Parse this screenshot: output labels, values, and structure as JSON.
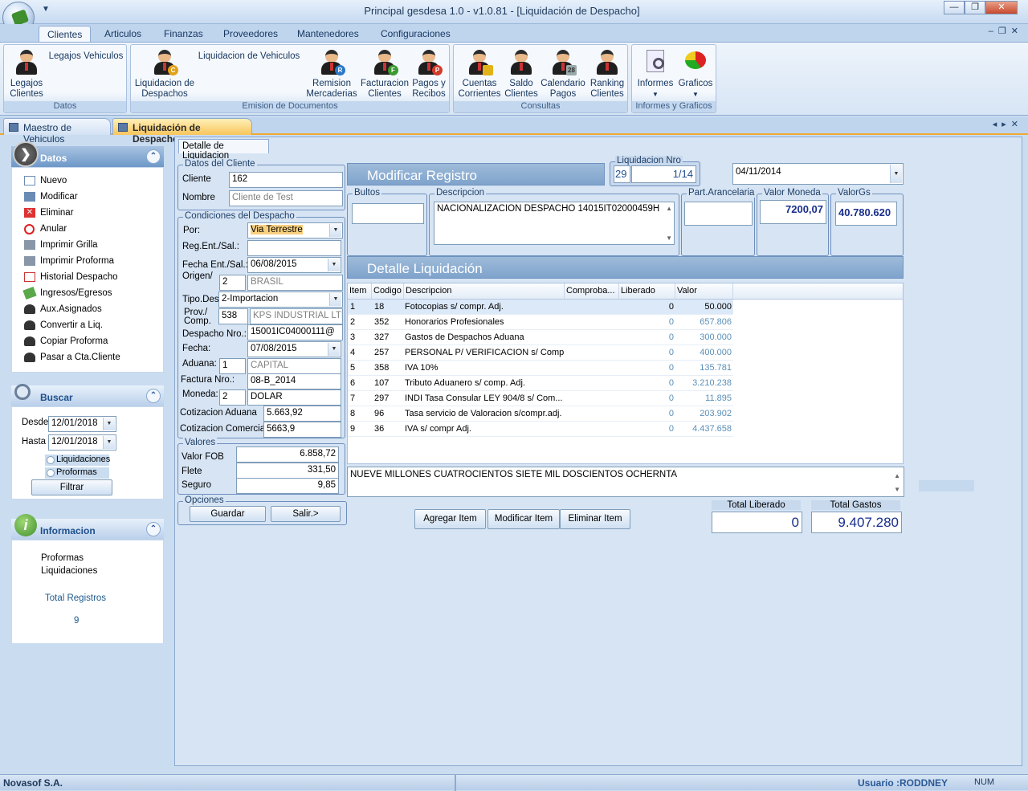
{
  "app": {
    "title": "Principal gesdesa 1.0 - v1.0.81 - [Liquidación de Despacho]"
  },
  "ribbon": {
    "tabs": [
      "Clientes",
      "Articulos",
      "Finanzas",
      "Proveedores",
      "Mantenedores",
      "Configuraciones"
    ],
    "groups": {
      "datos": {
        "label": "Datos",
        "buttons": [
          "Legajos Clientes",
          "Legajos Vehiculos"
        ]
      },
      "emision": {
        "label": "Emision de Documentos",
        "buttons": [
          "Liquidacion de Despachos",
          "Liquidacion de Vehiculos",
          "Remision Mercaderias",
          "Facturacion Clientes",
          "Pagos y Recibos"
        ]
      },
      "consultas": {
        "label": "Consultas",
        "buttons": [
          "Cuentas Corrientes",
          "Saldo Clientes",
          "Calendario Pagos",
          "Ranking Clientes"
        ]
      },
      "informes": {
        "label": "Informes y Graficos",
        "buttons": [
          "Informes",
          "Graficos"
        ]
      }
    }
  },
  "doc_tabs": [
    "Maestro de Vehiculos",
    "Liquidación de Despacho"
  ],
  "left": {
    "datos": {
      "title": "Datos",
      "items": [
        "Nuevo",
        "Modificar",
        "Eliminar",
        "Anular",
        "Imprimir Grilla",
        "Imprimir Proforma",
        "Historial Despacho",
        "Ingresos/Egresos",
        "Aux.Asignados",
        "Convertir a Liq.",
        "Copiar Proforma",
        "Pasar a Cta.Cliente"
      ]
    },
    "buscar": {
      "title": "Buscar",
      "desde_label": "Desde",
      "desde": "12/01/2018",
      "hasta_label": "Hasta",
      "hasta": "12/01/2018",
      "opt1": "Liquidaciones",
      "opt2": "Proformas",
      "filtrar": "Filtrar"
    },
    "info": {
      "title": "Informacion",
      "line1": "Proformas",
      "line2": "Liquidaciones",
      "total_label": "Total Registros",
      "total": "9"
    }
  },
  "form": {
    "tab": "Detalle de Liquidacion",
    "cliente": {
      "legend": "Datos del Cliente",
      "cliente_label": "Cliente",
      "cliente": "162",
      "nombre_label": "Nombre",
      "nombre_placeholder": "Cliente de Test"
    },
    "condiciones": {
      "legend": "Condiciones del Despacho",
      "por_label": "Por:",
      "por": "Via Terrestre",
      "reg_label": "Reg.Ent./Sal.:",
      "reg": "",
      "fecha_ent_label": "Fecha Ent./Sal.:",
      "fecha_ent": "06/08/2015",
      "origen_label": "Origen/",
      "origen_code": "2",
      "origen": "BRASIL",
      "tipo_label": "Tipo.Des",
      "tipo": "2-Importacion",
      "prov_label1": "Prov./",
      "prov_label2": "Comp.",
      "prov_code": "538",
      "prov": "KPS INDUSTRIAL LTD",
      "despacho_label": "Despacho Nro.:",
      "despacho": "15001IC04000111@",
      "fecha_label": "Fecha:",
      "fecha": "07/08/2015",
      "aduana_label": "Aduana:",
      "aduana_code": "1",
      "aduana": "CAPITAL",
      "factura_label": "Factura Nro.:",
      "factura": "08-B_2014",
      "moneda_label": "Moneda:",
      "moneda_code": "2",
      "moneda": "DOLAR",
      "cot_aduana_label": "Cotizacion Aduana",
      "cot_aduana": "5.663,92",
      "cot_comercial_label": "Cotizacion Comercial",
      "cot_comercial": "5663,9"
    },
    "valores": {
      "legend": "Valores",
      "fob_label": "Valor FOB",
      "fob": "6.858,72",
      "flete_label": "Flete",
      "flete": "331,50",
      "seguro_label": "Seguro",
      "seguro": "9,85"
    },
    "opciones": {
      "legend": "Opciones",
      "guardar": "Guardar",
      "salir": "Salir.>"
    },
    "modificar_title": "Modificar Registro",
    "liq_nro": {
      "legend": "Liquidacion Nro",
      "left": "29",
      "right": "1/14"
    },
    "fecha_liq": "04/11/2014",
    "bultos": {
      "legend": "Bultos",
      "value": ""
    },
    "descripcion": {
      "legend": "Descripcion",
      "value": "NACIONALIZACION DESPACHO 14015IT02000459H"
    },
    "part": {
      "legend": "Part.Arancelaria",
      "value": ""
    },
    "valor_moneda": {
      "legend": "Valor Moneda",
      "value": "7200,07"
    },
    "valor_gs": {
      "legend": "ValorGs",
      "value": "40.780.620"
    },
    "detalle_title": "Detalle Liquidación",
    "columns": [
      "Item",
      "Codigo",
      "Descripcion",
      "Comproba...",
      "Liberado",
      "Valor"
    ],
    "rows": [
      [
        "1",
        "18",
        "Fotocopias s/ compr. Adj.",
        "",
        "0",
        "50.000"
      ],
      [
        "2",
        "352",
        "Honorarios Profesionales",
        "",
        "0",
        "657.806"
      ],
      [
        "3",
        "327",
        "Gastos de Despachos Aduana",
        "",
        "0",
        "300.000"
      ],
      [
        "4",
        "257",
        "PERSONAL P/ VERIFICACION s/ Comp...",
        "",
        "0",
        "400.000"
      ],
      [
        "5",
        "358",
        "IVA 10%",
        "",
        "0",
        "135.781"
      ],
      [
        "6",
        "107",
        "Tributo Aduanero s/ comp. Adj.",
        "",
        "0",
        "3.210.238"
      ],
      [
        "7",
        "297",
        "INDI Tasa Consular LEY 904/8 s/ Com...",
        "",
        "0",
        "11.895"
      ],
      [
        "8",
        "96",
        "Tasa servicio de Valoracion s/compr.adj.",
        "",
        "0",
        "203.902"
      ],
      [
        "9",
        "36",
        "IVA s/ compr Adj.",
        "",
        "0",
        "4.437.658"
      ]
    ],
    "monto_letras": "NUEVE MILLONES CUATROCIENTOS SIETE MIL DOSCIENTOS OCHERNTA",
    "agregar": "Agregar Item",
    "modificar": "Modificar Item",
    "eliminar": "Eliminar Item",
    "total_liberado_label": "Total Liberado",
    "total_liberado": "0",
    "total_gastos_label": "Total Gastos",
    "total_gastos": "9.407.280"
  },
  "status": {
    "company": "Novasof S.A.",
    "user": "Usuario :RODDNEY",
    "num": "NUM"
  }
}
